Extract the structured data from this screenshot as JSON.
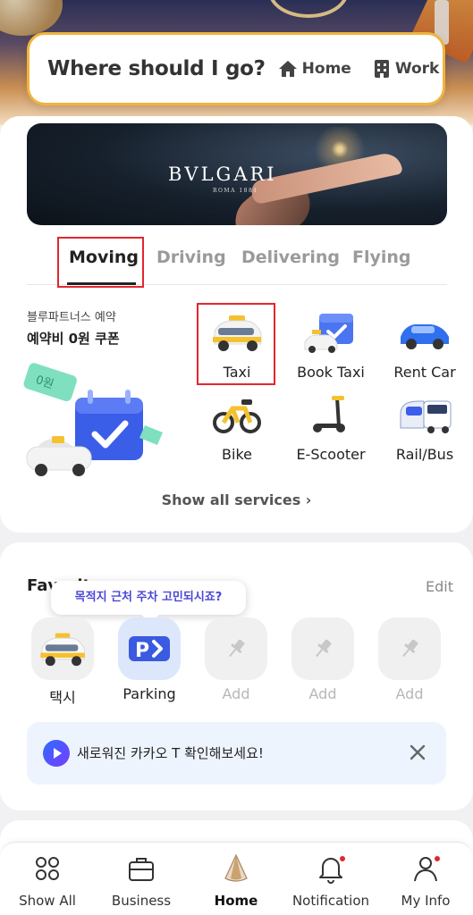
{
  "search": {
    "placeholder": "Where should I go?",
    "home_label": "Home",
    "work_label": "Work"
  },
  "banner": {
    "brand": "BVLGARI",
    "brand_sub": "ROMA 1884"
  },
  "tabs": [
    {
      "label": "Moving",
      "active": true
    },
    {
      "label": "Driving"
    },
    {
      "label": "Delivering"
    },
    {
      "label": "Flying"
    }
  ],
  "promo": {
    "line1": "블루파트너스 예약",
    "line2": "예약비 0원 쿠폰",
    "ticket": "0원"
  },
  "services": [
    {
      "label": "Taxi",
      "icon": "taxi-icon"
    },
    {
      "label": "Book Taxi",
      "icon": "book-taxi-icon"
    },
    {
      "label": "Rent Car",
      "icon": "rent-car-icon"
    },
    {
      "label": "Bike",
      "icon": "bike-icon"
    },
    {
      "label": "E-Scooter",
      "icon": "e-scooter-icon"
    },
    {
      "label": "Rail/Bus",
      "icon": "rail-bus-icon"
    }
  ],
  "show_all": "Show all services ›",
  "favorites": {
    "title": "Favorites",
    "edit": "Edit",
    "tooltip": "목적지 근처 주차 고민되시죠?",
    "items": [
      {
        "label": "택시",
        "icon": "taxi-icon"
      },
      {
        "label": "Parking",
        "icon": "parking-icon"
      },
      {
        "label": "Add",
        "icon": "pin-icon"
      },
      {
        "label": "Add",
        "icon": "pin-icon"
      },
      {
        "label": "Add",
        "icon": "pin-icon"
      }
    ]
  },
  "notice": {
    "text": "새로워진 카카오 T 확인해보세요!"
  },
  "nav": [
    {
      "label": "Show All",
      "icon": "grid-circles-icon"
    },
    {
      "label": "Business",
      "icon": "briefcase-icon"
    },
    {
      "label": "Home",
      "icon": "home-cone-icon",
      "active": true
    },
    {
      "label": "Notification",
      "icon": "bell-icon"
    },
    {
      "label": "My Info",
      "icon": "person-icon"
    }
  ],
  "colors": {
    "accent": "#f0b43c",
    "highlight_box": "#e3262f",
    "tooltip_text": "#4b47d6",
    "notice_bg": "#eef4fd"
  }
}
